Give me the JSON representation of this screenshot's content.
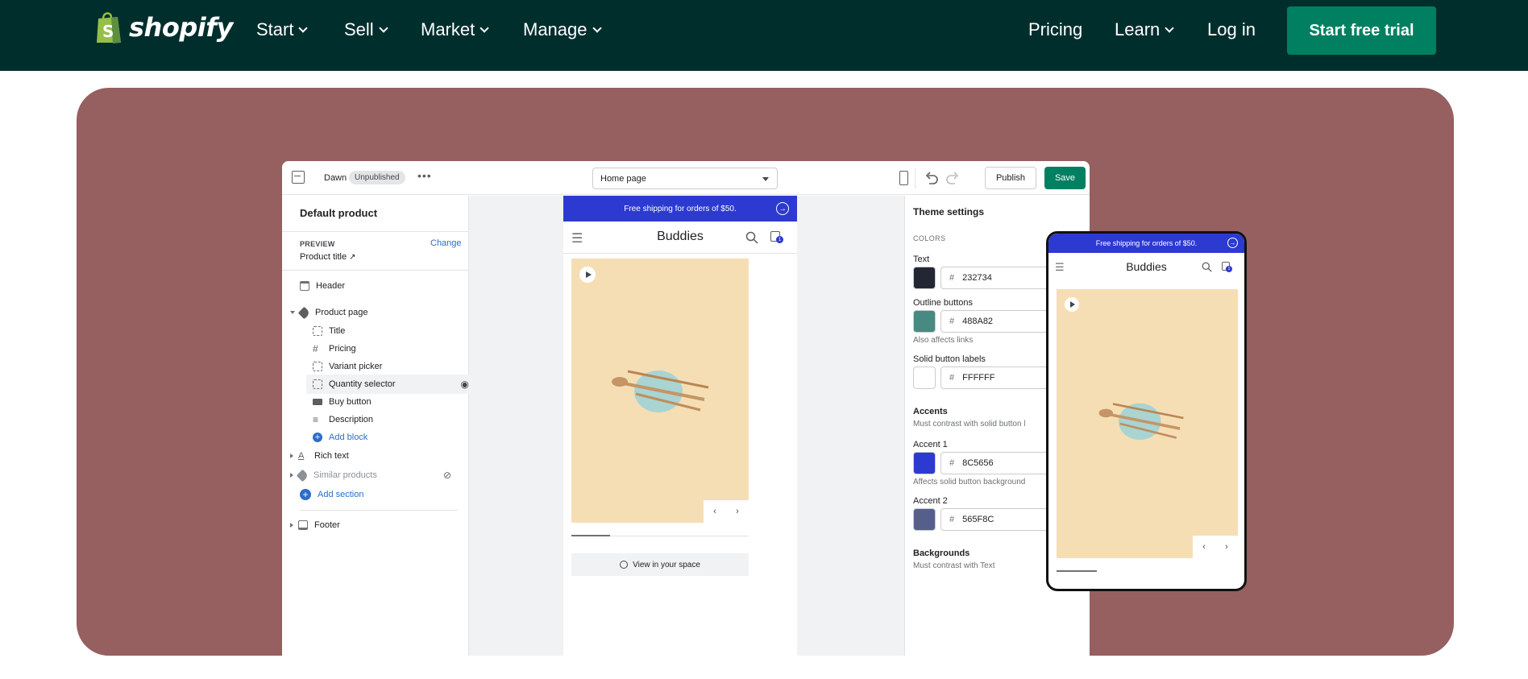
{
  "nav": {
    "logo_text": "shopify",
    "items": [
      {
        "label": "Start"
      },
      {
        "label": "Sell"
      },
      {
        "label": "Market"
      },
      {
        "label": "Manage"
      }
    ],
    "right_items": [
      {
        "label": "Pricing"
      },
      {
        "label": "Learn"
      },
      {
        "label": "Log in"
      }
    ],
    "cta": "Start free trial",
    "colors": {
      "nav_bg": "#002e2d",
      "cta_bg": "#008060",
      "hero_bg": "#965f60"
    }
  },
  "editor": {
    "theme_name": "Dawn",
    "status_badge": "Unpublished",
    "page_select": "Home page",
    "publish": "Publish",
    "save": "Save",
    "left": {
      "title": "Default product",
      "preview_label": "PREVIEW",
      "change_link": "Change",
      "preview_value": "Product title",
      "header": "Header",
      "product_page": "Product page",
      "blocks": [
        "Title",
        "Pricing",
        "Variant picker",
        "Quantity selector",
        "Buy button",
        "Description"
      ],
      "add_block": "Add block",
      "rich_text": "Rich text",
      "similar_products": "Similar products",
      "add_section": "Add section",
      "footer": "Footer"
    },
    "canvas": {
      "banner": "Free shipping for orders of $50.",
      "store_name": "Buddies",
      "cart_count": "1",
      "view_in_space": "View in your space"
    },
    "right": {
      "title": "Theme settings",
      "colors_heading": "COLORS",
      "text_label": "Text",
      "text_hex": "232734",
      "outline_label": "Outline buttons",
      "outline_hex": "488A82",
      "outline_note": "Also affects links",
      "solid_label": "Solid button labels",
      "solid_hex": "FFFFFF",
      "accents_heading": "Accents",
      "accents_note": "Must contrast with solid button l",
      "accent1_label": "Accent 1",
      "accent1_hex": "8C5656",
      "accent1_note": "Affects solid button background",
      "accent2_label": "Accent 2",
      "accent2_hex": "565F8C",
      "backgrounds_heading": "Backgrounds",
      "backgrounds_note": "Must contrast with Text",
      "hash": "#"
    }
  },
  "phone": {
    "banner": "Free shipping for orders of $50.",
    "store_name": "Buddies",
    "cart_count": "1"
  }
}
